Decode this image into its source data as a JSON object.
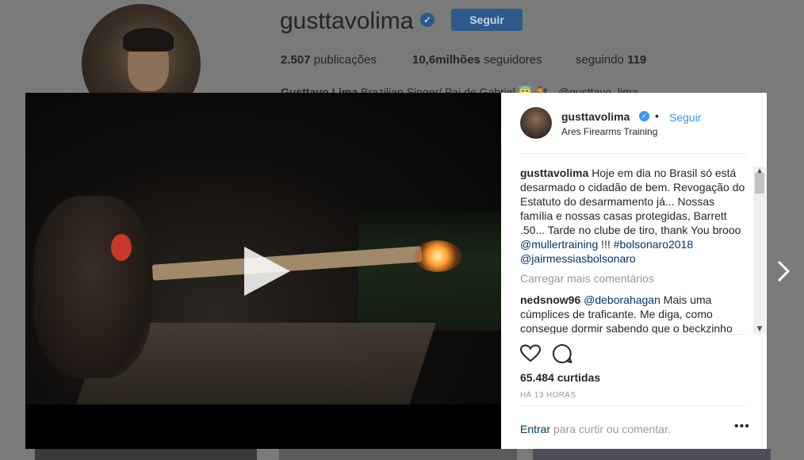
{
  "profile": {
    "username": "gusttavolima",
    "follow_label": "Seguir",
    "posts_count": "2.507",
    "posts_label": "publicações",
    "followers_count": "10,6milhões",
    "followers_label": "seguidores",
    "following_label": "seguindo",
    "following_count": "119",
    "bio_name": "Gusttavo Lima",
    "bio_text": "Brazilian Singer/ Pai de Gabriel 😇 🐓",
    "bio_handle": "@gusttavo_lima"
  },
  "post": {
    "author": "gusttavolima",
    "dot": "•",
    "follow_label": "Seguir",
    "location": "Ares Firearms Training",
    "caption_user": "gusttavolima",
    "caption_text": " Hoje em dia no Brasil só está desarmado o cidadão de bem. Revogação do Estatuto do desarmamento já... Nossas família e nossas casas protegidas, Barrett .50... Tarde no clube de tiro, thank You brooo ",
    "caption_mention": "@mullertraining",
    "caption_sep": " !!! ",
    "caption_hashtag": "#bolsonaro2018",
    "caption_mention2": "@jairmessiasbolsonaro",
    "load_more": "Carregar mais comentários",
    "comment_user": "nedsnow96",
    "comment_mention": "@deborahagan",
    "comment_text": " Mais uma cúmplices de traficante. Me diga, como consegue dormir sabendo que o beckzinho",
    "likes": "65.484 curtidas",
    "time": "HÁ 13 HORAS",
    "login_link": "Entrar",
    "login_text": " para curtir ou comentar.",
    "more": "•••"
  },
  "icons": {
    "heart": "heart-icon",
    "comment": "comment-icon",
    "play": "play-icon",
    "next": "chevron-right-icon",
    "verified": "verified-badge-icon"
  },
  "colors": {
    "link": "#003569",
    "accent": "#3897f0",
    "muted": "#999999"
  }
}
